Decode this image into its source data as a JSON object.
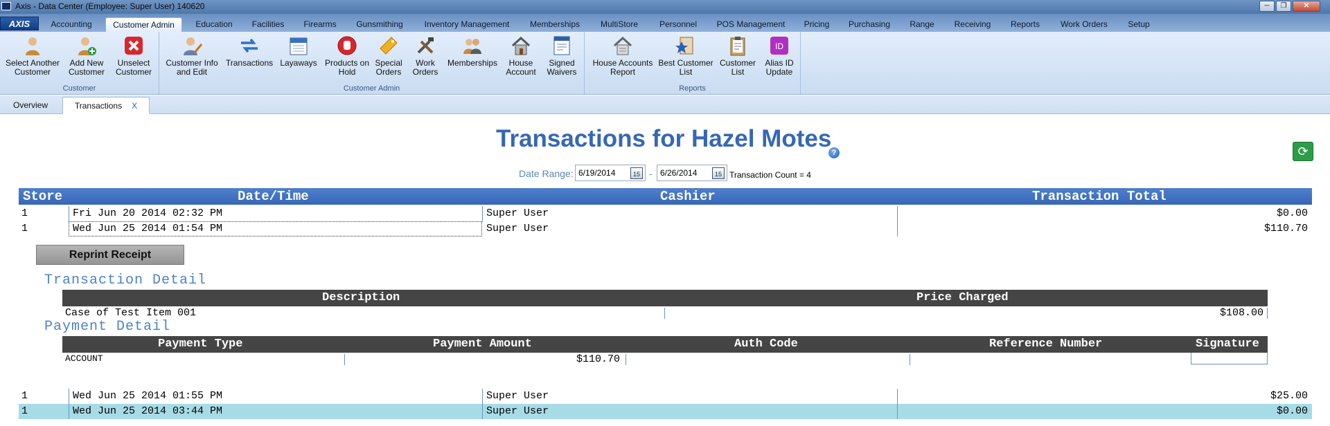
{
  "window": {
    "title": "Axis - Data Center  (Employee: Super User) 140620",
    "minimize": "─",
    "restore": "❐",
    "close": "✕"
  },
  "ribbon_tabs": {
    "logo": "AXIS",
    "items": [
      "Accounting",
      "Customer Admin",
      "Education",
      "Facilities",
      "Firearms",
      "Gunsmithing",
      "Inventory Management",
      "Memberships",
      "MultiStore",
      "Personnel",
      "POS Management",
      "Pricing",
      "Purchasing",
      "Range",
      "Receiving",
      "Reports",
      "Work Orders",
      "Setup"
    ],
    "active": "Customer Admin"
  },
  "ribbon": {
    "groups": [
      {
        "label": "Customer",
        "buttons": [
          {
            "line1": "Select Another",
            "line2": "Customer",
            "icon": "person-icon"
          },
          {
            "line1": "Add New",
            "line2": "Customer",
            "icon": "person-add-icon"
          },
          {
            "line1": "Unselect",
            "line2": "Customer",
            "icon": "red-x-icon"
          }
        ]
      },
      {
        "label": "Customer Admin",
        "buttons": [
          {
            "line1": "Customer Info",
            "line2": "and Edit",
            "icon": "person-edit-icon"
          },
          {
            "line1": "Transactions",
            "line2": "",
            "icon": "arrows-exchange-icon"
          },
          {
            "line1": "Layaways",
            "line2": "",
            "icon": "calendar-icon"
          },
          {
            "line1": "Products on",
            "line2": "Hold",
            "icon": "stop-hand-icon"
          },
          {
            "line1": "Special",
            "line2": "Orders",
            "icon": "special-tag-icon"
          },
          {
            "line1": "Work",
            "line2": "Orders",
            "icon": "tools-icon"
          },
          {
            "line1": "Memberships",
            "line2": "",
            "icon": "people-icon"
          },
          {
            "line1": "House",
            "line2": "Account",
            "icon": "house-icon"
          },
          {
            "line1": "Signed",
            "line2": "Waivers",
            "icon": "waiver-document-icon"
          }
        ]
      },
      {
        "label": "Reports",
        "buttons": [
          {
            "line1": "House Accounts",
            "line2": "Report",
            "icon": "house-report-icon"
          },
          {
            "line1": "Best Customer",
            "line2": "List",
            "icon": "star-badge-icon"
          },
          {
            "line1": "Customer",
            "line2": "List",
            "icon": "clipboard-icon"
          },
          {
            "line1": "Alias ID",
            "line2": "Update",
            "icon": "id-badge-icon"
          }
        ]
      }
    ]
  },
  "doc_tabs": {
    "overview": "Overview",
    "transactions": "Transactions",
    "close": "X"
  },
  "page": {
    "title": "Transactions for Hazel Motes",
    "help": "?",
    "refresh": "⟳",
    "date_range_label": "Date Range:",
    "start_date": "6/19/2014",
    "end_date": "6/26/2014",
    "calendar_day": "15",
    "dash": "-",
    "transaction_count": "Transaction Count = 4"
  },
  "transactions": {
    "columns": [
      "Store",
      "Date/Time",
      "Cashier",
      "Transaction Total"
    ],
    "rows": [
      {
        "store": "1",
        "datetime": "Fri Jun 20 2014 02:32 PM",
        "cashier": "Super User",
        "total": "$0.00"
      },
      {
        "store": "1",
        "datetime": "Wed Jun 25 2014 01:54 PM",
        "cashier": "Super User",
        "total": "$110.70"
      },
      {
        "store": "1",
        "datetime": "Wed Jun 25 2014 01:55 PM",
        "cashier": "Super User",
        "total": "$25.00"
      },
      {
        "store": "1",
        "datetime": "Wed Jun 25 2014 03:44 PM",
        "cashier": "Super User",
        "total": "$0.00"
      }
    ]
  },
  "detail": {
    "reprint_label": "Reprint Receipt",
    "transaction_detail_title": "Transaction Detail",
    "item_columns": [
      "Description",
      "Price Charged"
    ],
    "items": [
      {
        "description": "Case of Test Item 001",
        "price": "$108.00"
      }
    ],
    "payment_detail_title": "Payment Detail",
    "payment_columns": [
      "Payment Type",
      "Payment Amount",
      "Auth Code",
      "Reference Number",
      "Signature"
    ],
    "payments": [
      {
        "type": "ACCOUNT",
        "amount": "$110.70",
        "auth": "",
        "reference": "",
        "signature": ""
      }
    ]
  }
}
